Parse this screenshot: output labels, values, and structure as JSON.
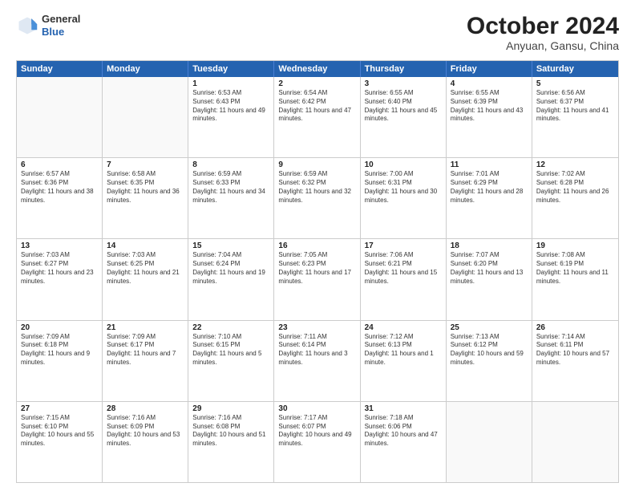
{
  "header": {
    "logo": {
      "general": "General",
      "blue": "Blue"
    },
    "title": "October 2024",
    "location": "Anyuan, Gansu, China"
  },
  "weekdays": [
    "Sunday",
    "Monday",
    "Tuesday",
    "Wednesday",
    "Thursday",
    "Friday",
    "Saturday"
  ],
  "rows": [
    [
      {
        "date": "",
        "info": ""
      },
      {
        "date": "",
        "info": ""
      },
      {
        "date": "1",
        "info": "Sunrise: 6:53 AM\nSunset: 6:43 PM\nDaylight: 11 hours and 49 minutes."
      },
      {
        "date": "2",
        "info": "Sunrise: 6:54 AM\nSunset: 6:42 PM\nDaylight: 11 hours and 47 minutes."
      },
      {
        "date": "3",
        "info": "Sunrise: 6:55 AM\nSunset: 6:40 PM\nDaylight: 11 hours and 45 minutes."
      },
      {
        "date": "4",
        "info": "Sunrise: 6:55 AM\nSunset: 6:39 PM\nDaylight: 11 hours and 43 minutes."
      },
      {
        "date": "5",
        "info": "Sunrise: 6:56 AM\nSunset: 6:37 PM\nDaylight: 11 hours and 41 minutes."
      }
    ],
    [
      {
        "date": "6",
        "info": "Sunrise: 6:57 AM\nSunset: 6:36 PM\nDaylight: 11 hours and 38 minutes."
      },
      {
        "date": "7",
        "info": "Sunrise: 6:58 AM\nSunset: 6:35 PM\nDaylight: 11 hours and 36 minutes."
      },
      {
        "date": "8",
        "info": "Sunrise: 6:59 AM\nSunset: 6:33 PM\nDaylight: 11 hours and 34 minutes."
      },
      {
        "date": "9",
        "info": "Sunrise: 6:59 AM\nSunset: 6:32 PM\nDaylight: 11 hours and 32 minutes."
      },
      {
        "date": "10",
        "info": "Sunrise: 7:00 AM\nSunset: 6:31 PM\nDaylight: 11 hours and 30 minutes."
      },
      {
        "date": "11",
        "info": "Sunrise: 7:01 AM\nSunset: 6:29 PM\nDaylight: 11 hours and 28 minutes."
      },
      {
        "date": "12",
        "info": "Sunrise: 7:02 AM\nSunset: 6:28 PM\nDaylight: 11 hours and 26 minutes."
      }
    ],
    [
      {
        "date": "13",
        "info": "Sunrise: 7:03 AM\nSunset: 6:27 PM\nDaylight: 11 hours and 23 minutes."
      },
      {
        "date": "14",
        "info": "Sunrise: 7:03 AM\nSunset: 6:25 PM\nDaylight: 11 hours and 21 minutes."
      },
      {
        "date": "15",
        "info": "Sunrise: 7:04 AM\nSunset: 6:24 PM\nDaylight: 11 hours and 19 minutes."
      },
      {
        "date": "16",
        "info": "Sunrise: 7:05 AM\nSunset: 6:23 PM\nDaylight: 11 hours and 17 minutes."
      },
      {
        "date": "17",
        "info": "Sunrise: 7:06 AM\nSunset: 6:21 PM\nDaylight: 11 hours and 15 minutes."
      },
      {
        "date": "18",
        "info": "Sunrise: 7:07 AM\nSunset: 6:20 PM\nDaylight: 11 hours and 13 minutes."
      },
      {
        "date": "19",
        "info": "Sunrise: 7:08 AM\nSunset: 6:19 PM\nDaylight: 11 hours and 11 minutes."
      }
    ],
    [
      {
        "date": "20",
        "info": "Sunrise: 7:09 AM\nSunset: 6:18 PM\nDaylight: 11 hours and 9 minutes."
      },
      {
        "date": "21",
        "info": "Sunrise: 7:09 AM\nSunset: 6:17 PM\nDaylight: 11 hours and 7 minutes."
      },
      {
        "date": "22",
        "info": "Sunrise: 7:10 AM\nSunset: 6:15 PM\nDaylight: 11 hours and 5 minutes."
      },
      {
        "date": "23",
        "info": "Sunrise: 7:11 AM\nSunset: 6:14 PM\nDaylight: 11 hours and 3 minutes."
      },
      {
        "date": "24",
        "info": "Sunrise: 7:12 AM\nSunset: 6:13 PM\nDaylight: 11 hours and 1 minute."
      },
      {
        "date": "25",
        "info": "Sunrise: 7:13 AM\nSunset: 6:12 PM\nDaylight: 10 hours and 59 minutes."
      },
      {
        "date": "26",
        "info": "Sunrise: 7:14 AM\nSunset: 6:11 PM\nDaylight: 10 hours and 57 minutes."
      }
    ],
    [
      {
        "date": "27",
        "info": "Sunrise: 7:15 AM\nSunset: 6:10 PM\nDaylight: 10 hours and 55 minutes."
      },
      {
        "date": "28",
        "info": "Sunrise: 7:16 AM\nSunset: 6:09 PM\nDaylight: 10 hours and 53 minutes."
      },
      {
        "date": "29",
        "info": "Sunrise: 7:16 AM\nSunset: 6:08 PM\nDaylight: 10 hours and 51 minutes."
      },
      {
        "date": "30",
        "info": "Sunrise: 7:17 AM\nSunset: 6:07 PM\nDaylight: 10 hours and 49 minutes."
      },
      {
        "date": "31",
        "info": "Sunrise: 7:18 AM\nSunset: 6:06 PM\nDaylight: 10 hours and 47 minutes."
      },
      {
        "date": "",
        "info": ""
      },
      {
        "date": "",
        "info": ""
      }
    ]
  ]
}
